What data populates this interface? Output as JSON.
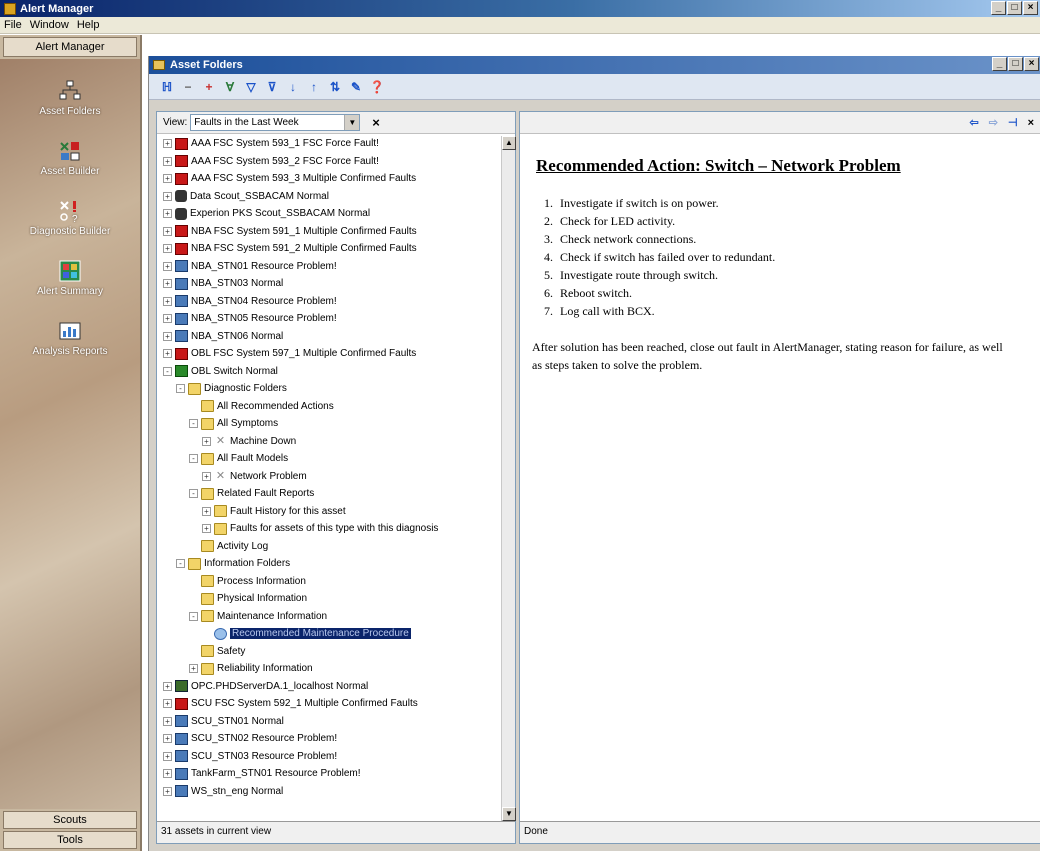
{
  "app": {
    "title": "Alert Manager"
  },
  "menu": [
    "File",
    "Window",
    "Help"
  ],
  "sidebar": {
    "header": "Alert Manager",
    "items": [
      {
        "label": "Asset Folders",
        "icon": "asset-folders-icon"
      },
      {
        "label": "Asset Builder",
        "icon": "asset-builder-icon"
      },
      {
        "label": "Diagnostic Builder",
        "icon": "diagnostic-builder-icon"
      },
      {
        "label": "Alert Summary",
        "icon": "alert-summary-icon"
      },
      {
        "label": "Analysis Reports",
        "icon": "analysis-reports-icon"
      }
    ],
    "footer_buttons": [
      "Scouts",
      "Tools"
    ]
  },
  "child_window": {
    "title": "Asset Folders"
  },
  "view": {
    "label": "View:",
    "selected": "Faults in the Last Week"
  },
  "tree": [
    {
      "label": "AAA FSC System 593_1 FSC Force Fault!",
      "icon": "red",
      "level": 0,
      "exp": "+"
    },
    {
      "label": "AAA FSC System 593_2 FSC Force Fault!",
      "icon": "red",
      "level": 0,
      "exp": "+"
    },
    {
      "label": "AAA FSC System 593_3 Multiple Confirmed Faults",
      "icon": "red",
      "level": 0,
      "exp": "+"
    },
    {
      "label": "Data Scout_SSBACAM Normal",
      "icon": "binoc",
      "level": 0,
      "exp": "+"
    },
    {
      "label": "Experion PKS Scout_SSBACAM Normal",
      "icon": "binoc",
      "level": 0,
      "exp": "+"
    },
    {
      "label": "NBA FSC System 591_1 Multiple Confirmed Faults",
      "icon": "red",
      "level": 0,
      "exp": "+"
    },
    {
      "label": "NBA FSC System 591_2 Multiple Confirmed Faults",
      "icon": "red",
      "level": 0,
      "exp": "+"
    },
    {
      "label": "NBA_STN01 Resource Problem!",
      "icon": "pcbox",
      "level": 0,
      "exp": "+"
    },
    {
      "label": "NBA_STN03 Normal",
      "icon": "pcbox",
      "level": 0,
      "exp": "+"
    },
    {
      "label": "NBA_STN04 Resource Problem!",
      "icon": "pcbox",
      "level": 0,
      "exp": "+"
    },
    {
      "label": "NBA_STN05 Resource Problem!",
      "icon": "pcbox",
      "level": 0,
      "exp": "+"
    },
    {
      "label": "NBA_STN06 Normal",
      "icon": "pcbox",
      "level": 0,
      "exp": "+"
    },
    {
      "label": "OBL FSC System 597_1 Multiple Confirmed Faults",
      "icon": "red",
      "level": 0,
      "exp": "+"
    },
    {
      "label": "OBL Switch Normal",
      "icon": "green",
      "level": 0,
      "exp": "-"
    },
    {
      "label": "Diagnostic Folders",
      "icon": "folder",
      "level": 1,
      "exp": "-"
    },
    {
      "label": "All Recommended Actions",
      "icon": "folder",
      "level": 2,
      "exp": ""
    },
    {
      "label": "All Symptoms",
      "icon": "folder",
      "level": 2,
      "exp": "-"
    },
    {
      "label": "Machine Down",
      "icon": "xmark",
      "level": 3,
      "exp": "+"
    },
    {
      "label": "All Fault Models",
      "icon": "folder",
      "level": 2,
      "exp": "-"
    },
    {
      "label": "Network Problem",
      "icon": "xmark",
      "level": 3,
      "exp": "+"
    },
    {
      "label": "Related Fault Reports",
      "icon": "folder",
      "level": 2,
      "exp": "-"
    },
    {
      "label": "Fault History for this asset",
      "icon": "folder",
      "level": 3,
      "exp": "+"
    },
    {
      "label": "Faults for assets of this type with this diagnosis",
      "icon": "folder",
      "level": 3,
      "exp": "+"
    },
    {
      "label": "Activity Log",
      "icon": "folder",
      "level": 2,
      "exp": ""
    },
    {
      "label": "Information Folders",
      "icon": "folder",
      "level": 1,
      "exp": "-"
    },
    {
      "label": "Process Information",
      "icon": "folder",
      "level": 2,
      "exp": ""
    },
    {
      "label": "Physical Information",
      "icon": "folder",
      "level": 2,
      "exp": ""
    },
    {
      "label": "Maintenance Information",
      "icon": "folder",
      "level": 2,
      "exp": "-"
    },
    {
      "label": "Recommended Maintenance Procedure",
      "icon": "doc",
      "level": 3,
      "exp": "",
      "selected": true
    },
    {
      "label": "Safety",
      "icon": "folder",
      "level": 2,
      "exp": ""
    },
    {
      "label": "Reliability Information",
      "icon": "folder",
      "level": 2,
      "exp": "+"
    },
    {
      "label": "OPC.PHDServerDA.1_localhost Normal",
      "icon": "opc",
      "level": 0,
      "exp": "+"
    },
    {
      "label": "SCU FSC System 592_1 Multiple Confirmed Faults",
      "icon": "red",
      "level": 0,
      "exp": "+"
    },
    {
      "label": "SCU_STN01 Normal",
      "icon": "pcbox",
      "level": 0,
      "exp": "+"
    },
    {
      "label": "SCU_STN02 Resource Problem!",
      "icon": "pcbox",
      "level": 0,
      "exp": "+"
    },
    {
      "label": "SCU_STN03 Resource Problem!",
      "icon": "pcbox",
      "level": 0,
      "exp": "+"
    },
    {
      "label": "TankFarm_STN01 Resource Problem!",
      "icon": "pcbox",
      "level": 0,
      "exp": "+"
    },
    {
      "label": "WS_stn_eng Normal",
      "icon": "pcbox",
      "level": 0,
      "exp": "+"
    }
  ],
  "status_left": "31 assets in current view",
  "document": {
    "heading": "Recommended Action: Switch – Network Problem",
    "steps": [
      "Investigate if switch is on power.",
      "Check for LED activity.",
      "Check network connections.",
      "Check if switch has failed over to redundant.",
      "Investigate route through switch.",
      "Reboot switch.",
      "Log call with BCX."
    ],
    "paragraph": "After solution has been reached, close out fault in AlertManager, stating reason for failure, as well as steps taken to solve the problem."
  },
  "status_right": "Done"
}
